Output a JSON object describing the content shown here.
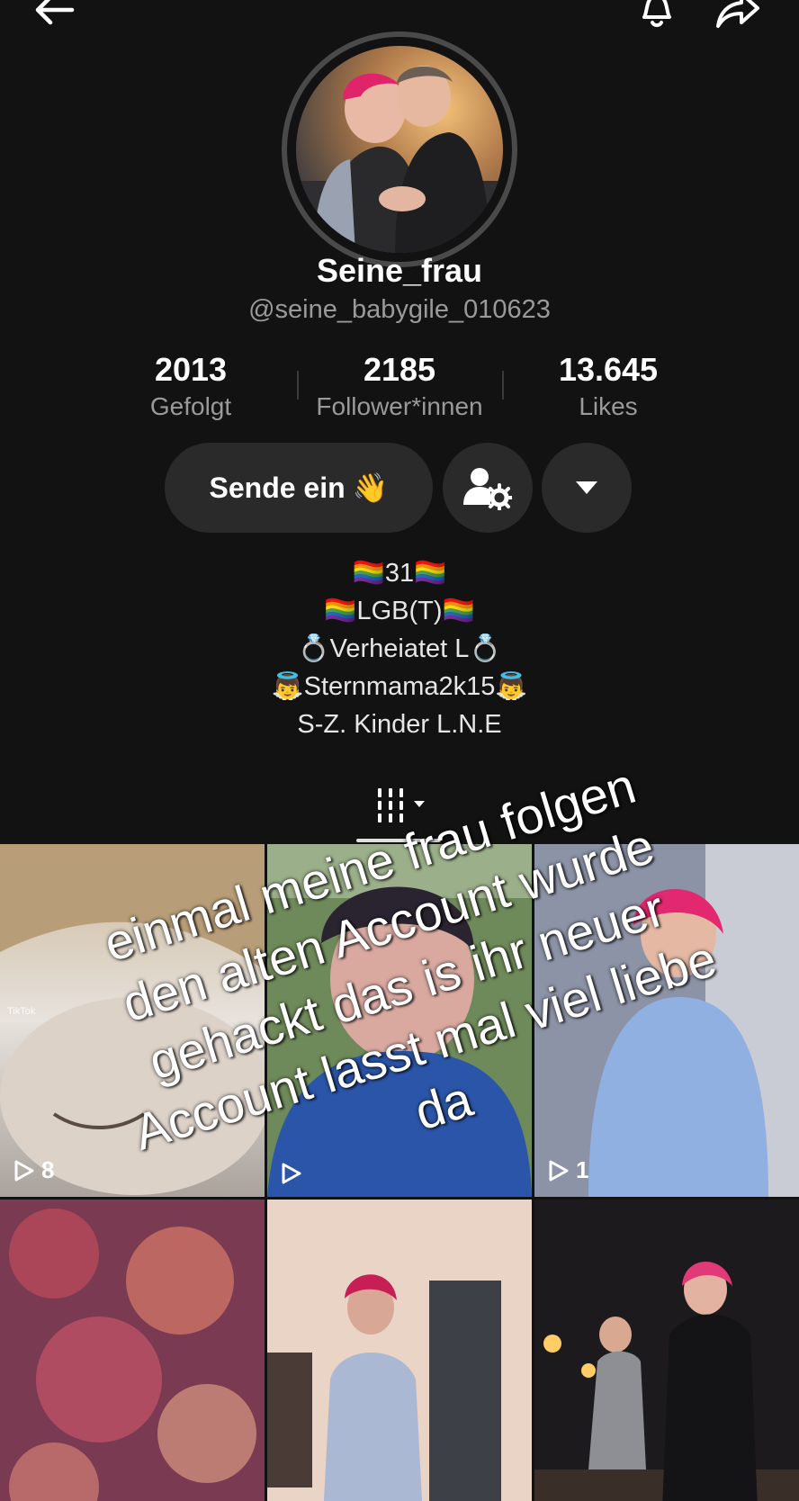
{
  "header": {
    "back_icon": "arrow-left-icon",
    "bell_icon": "bell-icon",
    "share_icon": "share-arrow-icon"
  },
  "profile": {
    "display_name": "Seine_frau",
    "handle": "@seine_babygile_010623"
  },
  "stats": [
    {
      "value": "2013",
      "label": "Gefolgt"
    },
    {
      "value": "2185",
      "label": "Follower*innen"
    },
    {
      "value": "13.645",
      "label": "Likes"
    }
  ],
  "actions": {
    "send_label": "Sende ein",
    "send_emoji": "👋",
    "person_settings_icon": "person-gear-icon",
    "more_icon": "caret-down-icon"
  },
  "bio": [
    "🏳️‍🌈31🏳️‍🌈",
    "🏳️‍🌈LGB(T)🏳️‍🌈",
    "💍Verheiatet L💍",
    "👼Sternmama2k15👼",
    "S-Z. Kinder  L.N.E"
  ],
  "tabs": {
    "active_icon": "videos-grid-icon"
  },
  "videos": [
    {
      "plays": "8"
    },
    {
      "plays": ""
    },
    {
      "plays": "1"
    },
    {
      "plays": ""
    },
    {
      "plays": ""
    },
    {
      "plays": ""
    }
  ],
  "video_watermark": "TikTok",
  "overlay_caption": [
    "einmal meine frau folgen",
    "den alten Account wurde",
    "gehackt das is ihr neuer",
    "Account lasst mal viel liebe",
    "da"
  ]
}
